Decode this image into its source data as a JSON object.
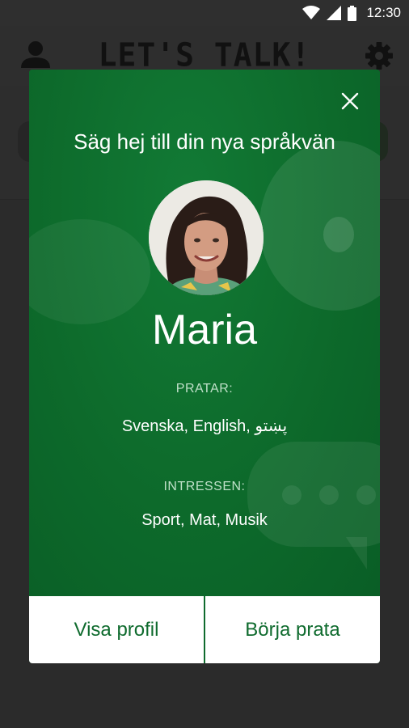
{
  "status_bar": {
    "time": "12:30"
  },
  "app_bar": {
    "logo": "LET'S TALK!"
  },
  "dialog": {
    "title": "Säg hej till din nya språkvän",
    "name": "Maria",
    "speaks_label": "PRATAR:",
    "speaks_value": "Svenska, English, پښتو",
    "interests_label": "INTRESSEN:",
    "interests_value": "Sport, Mat, Musik",
    "view_profile_label": "Visa profil",
    "start_talking_label": "Börja prata"
  },
  "colors": {
    "accent": "#0f6b2e",
    "background": "#2b2b2b"
  }
}
